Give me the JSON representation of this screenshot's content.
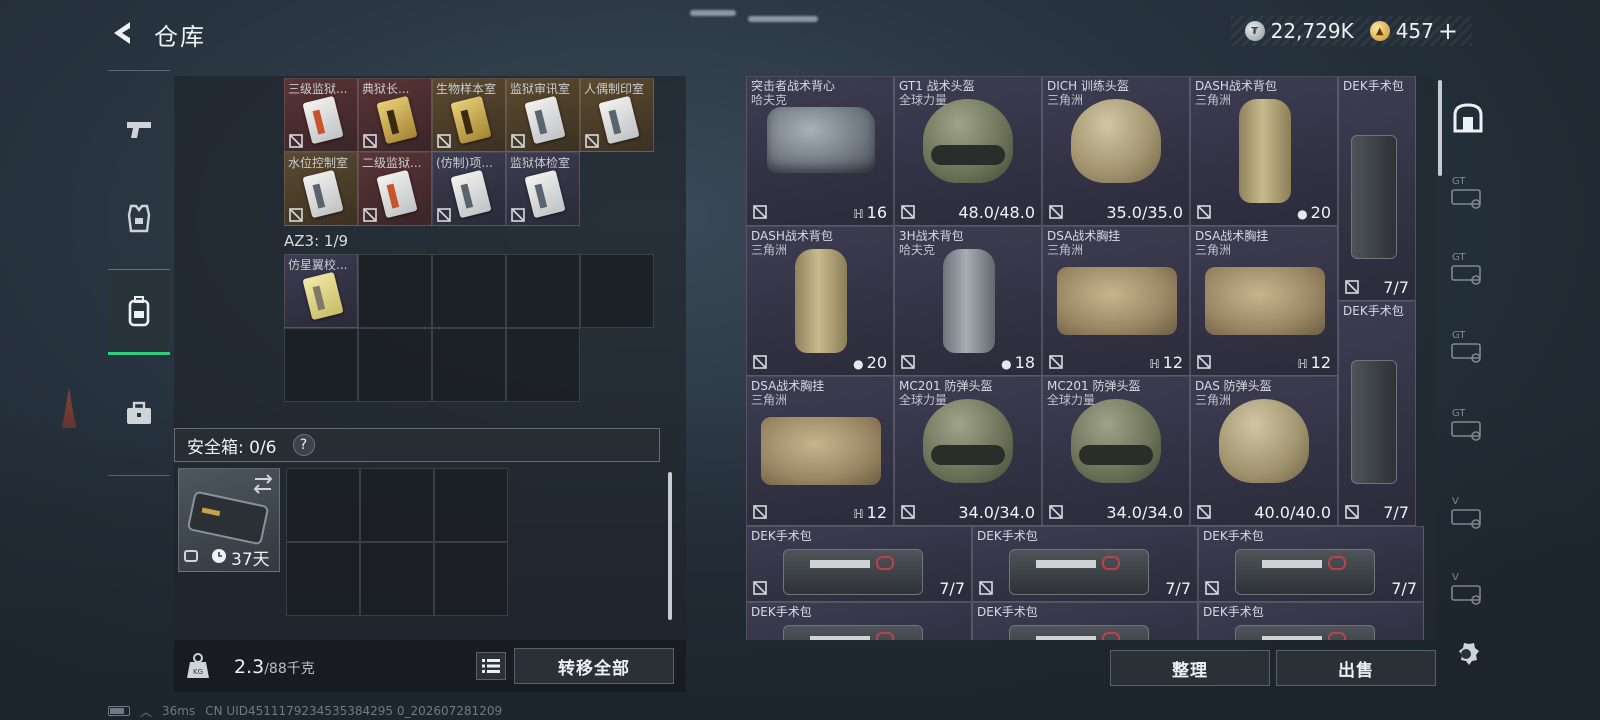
{
  "header": {
    "title": "仓库",
    "currency_silver": "22,729K",
    "currency_gold": "457",
    "plus": "+"
  },
  "left_tabs": [
    {
      "name": "weapons",
      "icon": "pistol-icon",
      "active": false
    },
    {
      "name": "armor",
      "icon": "vest-icon",
      "active": false
    },
    {
      "name": "backpack",
      "icon": "backpack-icon",
      "active": true
    },
    {
      "name": "toolbox",
      "icon": "toolbox-icon",
      "active": false
    }
  ],
  "keycards": [
    {
      "label": "三级监狱...",
      "rarity": "red",
      "card": "red"
    },
    {
      "label": "典狱长...",
      "rarity": "red",
      "card": "gold"
    },
    {
      "label": "生物样本室",
      "rarity": "gold",
      "card": "gold"
    },
    {
      "label": "监狱审讯室",
      "rarity": "gold",
      "card": "silver"
    },
    {
      "label": "人偶制印室",
      "rarity": "gold",
      "card": "silver"
    },
    {
      "label": "水位控制室",
      "rarity": "gold",
      "card": "silver"
    },
    {
      "label": "二级监狱...",
      "rarity": "red",
      "card": "red"
    },
    {
      "label": "(仿制)项...",
      "rarity": "purple",
      "card": "silver"
    },
    {
      "label": "监狱体检室",
      "rarity": "purple",
      "card": "silver"
    }
  ],
  "az3": {
    "label": "AZ3: 1/9",
    "item_label": "仿星翼校..."
  },
  "safe_box": {
    "label": "安全箱: 0/6",
    "help": "?",
    "days": "37天"
  },
  "bottom": {
    "weight_value": "2.3",
    "weight_max": "/88千克",
    "transfer_all": "转移全部"
  },
  "right_items": [
    {
      "name": "突击者战术背心",
      "sub": "哈夫克",
      "value": "16",
      "sym": "vest",
      "img": "vest"
    },
    {
      "name": "GT1 战术头盔",
      "sub": "全球力量",
      "value": "48.0/48.0",
      "sym": "",
      "img": "helmet-olive"
    },
    {
      "name": "DICH 训练头盔",
      "sub": "三角洲",
      "value": "35.0/35.0",
      "sym": "",
      "img": "helmet-tan"
    },
    {
      "name": "DASH战术背包",
      "sub": "三角洲",
      "value": "20",
      "sym": "bag",
      "img": "bag"
    },
    {
      "name": "DASH战术背包",
      "sub": "三角洲",
      "value": "20",
      "sym": "bag",
      "img": "bag"
    },
    {
      "name": "3H战术背包",
      "sub": "哈夫克",
      "value": "18",
      "sym": "bag",
      "img": "bag-grey"
    },
    {
      "name": "DSA战术胸挂",
      "sub": "三角洲",
      "value": "12",
      "sym": "vest",
      "img": "duffel"
    },
    {
      "name": "DSA战术胸挂",
      "sub": "三角洲",
      "value": "12",
      "sym": "vest",
      "img": "duffel"
    },
    {
      "name": "DSA战术胸挂",
      "sub": "三角洲",
      "value": "12",
      "sym": "vest",
      "img": "duffel"
    },
    {
      "name": "MC201 防弹头盔",
      "sub": "全球力量",
      "value": "34.0/34.0",
      "sym": "",
      "img": "helmet-olive"
    },
    {
      "name": "MC201 防弹头盔",
      "sub": "全球力量",
      "value": "34.0/34.0",
      "sym": "",
      "img": "helmet-olive"
    },
    {
      "name": "DAS 防弹头盔",
      "sub": "三角洲",
      "value": "40.0/40.0",
      "sym": "",
      "img": "helmet-tan"
    }
  ],
  "medkit_side": [
    {
      "name": "DEK手术包",
      "value": "7/7"
    },
    {
      "name": "DEK手术包",
      "value": "7/7"
    }
  ],
  "medkit_row": [
    {
      "name": "DEK手术包",
      "value": "7/7"
    },
    {
      "name": "DEK手术包",
      "value": "7/7"
    },
    {
      "name": "DEK手术包",
      "value": "7/7"
    }
  ],
  "medkit_row2": [
    {
      "name": "DEK手术包"
    },
    {
      "name": "DEK手术包"
    },
    {
      "name": "DEK手术包"
    }
  ],
  "actions": {
    "sort": "整理",
    "sell": "出售"
  },
  "right_tabs": [
    {
      "icon": "all-items-icon",
      "label": "",
      "active": true
    },
    {
      "icon": "tab-gt-icon",
      "label": "GT",
      "active": false
    },
    {
      "icon": "tab-gt-icon",
      "label": "GT",
      "active": false
    },
    {
      "icon": "tab-gt-icon",
      "label": "GT",
      "active": false
    },
    {
      "icon": "tab-gt-icon",
      "label": "GT",
      "active": false
    },
    {
      "icon": "tab-v-icon",
      "label": "V",
      "active": false
    },
    {
      "icon": "tab-v-icon",
      "label": "V",
      "active": false
    }
  ],
  "status": {
    "ping": "36ms",
    "uid": "CN UID4511179234535384295 0_202607281209"
  }
}
